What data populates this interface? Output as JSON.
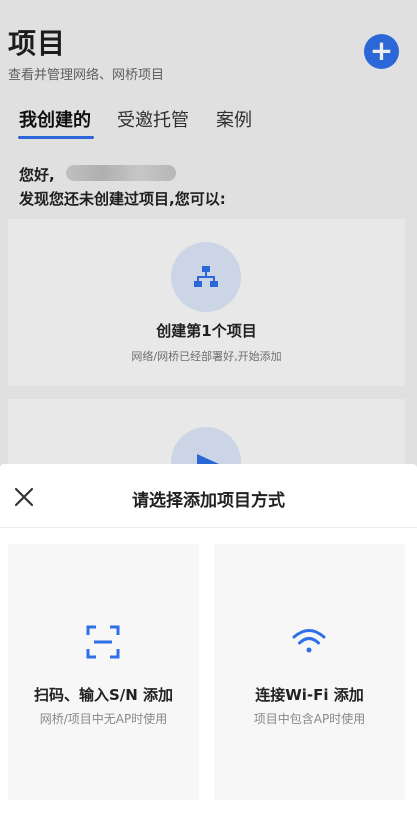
{
  "header": {
    "title": "项目",
    "subtitle": "查看并管理网络、网桥项目",
    "add_icon": "plus-icon"
  },
  "tabs": [
    {
      "label": "我创建的",
      "active": true
    },
    {
      "label": "受邀托管",
      "active": false
    },
    {
      "label": "案例",
      "active": false
    }
  ],
  "main": {
    "greeting": "您好,",
    "discover_text": "发现您还未创建过项目,您可以:",
    "card_create": {
      "icon": "network-topology-icon",
      "title": "创建第1个项目",
      "description": "网络/网桥已经部署好,开始添加"
    },
    "card_second": {
      "icon": "play-icon"
    }
  },
  "sheet": {
    "title": "请选择添加项目方式",
    "close_icon": "close-icon",
    "options": [
      {
        "icon": "scan-icon",
        "title": "扫码、输入S/N 添加",
        "description": "网桥/项目中无AP时使用"
      },
      {
        "icon": "wifi-icon",
        "title": "连接Wi-Fi 添加",
        "description": "项目中包含AP时使用"
      }
    ]
  },
  "colors": {
    "accent": "#2f6fe8",
    "icon_circle": "#dbe6f8"
  }
}
